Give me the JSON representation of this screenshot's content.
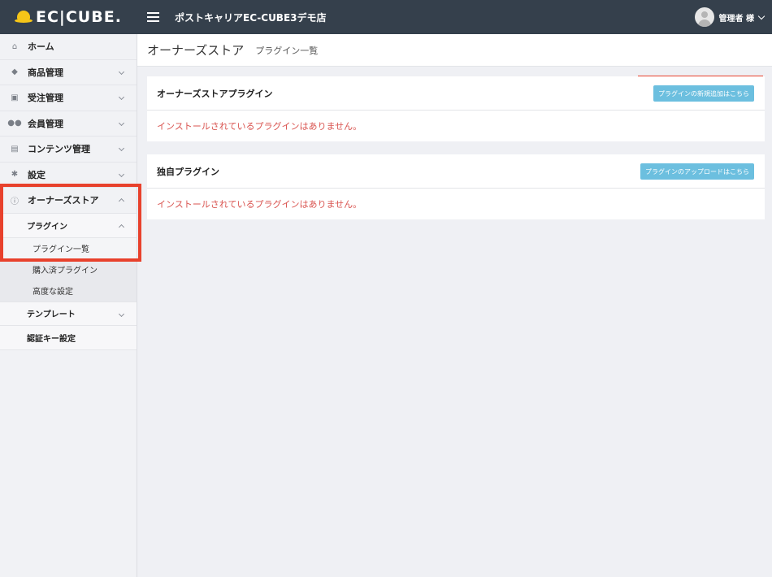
{
  "header": {
    "logo_text": "EC|CUBE.",
    "shop_name": "ポストキャリアEC-CUBE3デモ店",
    "user_name": "管理者 様"
  },
  "sidebar": {
    "items": [
      {
        "label": "ホーム",
        "icon": "home-icon"
      },
      {
        "label": "商品管理",
        "icon": "tag-icon"
      },
      {
        "label": "受注管理",
        "icon": "cart-icon"
      },
      {
        "label": "会員管理",
        "icon": "users-icon"
      },
      {
        "label": "コンテンツ管理",
        "icon": "file-icon"
      },
      {
        "label": "設定",
        "icon": "gear-icon"
      },
      {
        "label": "オーナーズストア",
        "icon": "info-icon"
      }
    ],
    "owners_store": {
      "plugin_label": "プラグイン",
      "plugin_children": [
        "プラグイン一覧",
        "購入済プラグイン",
        "高度な設定"
      ],
      "template_label": "テンプレート",
      "auth_key_label": "認証キー設定"
    }
  },
  "page": {
    "title": "オーナーズストア",
    "subtitle": "プラグイン一覧"
  },
  "cards": {
    "store": {
      "title": "オーナーズストアプラグイン",
      "button": "プラグインの新規追加はこちら",
      "message": "インストールされているプラグインはありません。"
    },
    "original": {
      "title": "独自プラグイン",
      "button": "プラグインのアップロードはこちら",
      "message": "インストールされているプラグインはありません。"
    }
  },
  "colors": {
    "header_bg": "#35404c",
    "accent_button": "#6cbfdf",
    "warning_text": "#d9534f",
    "highlight": "#e8412c"
  }
}
